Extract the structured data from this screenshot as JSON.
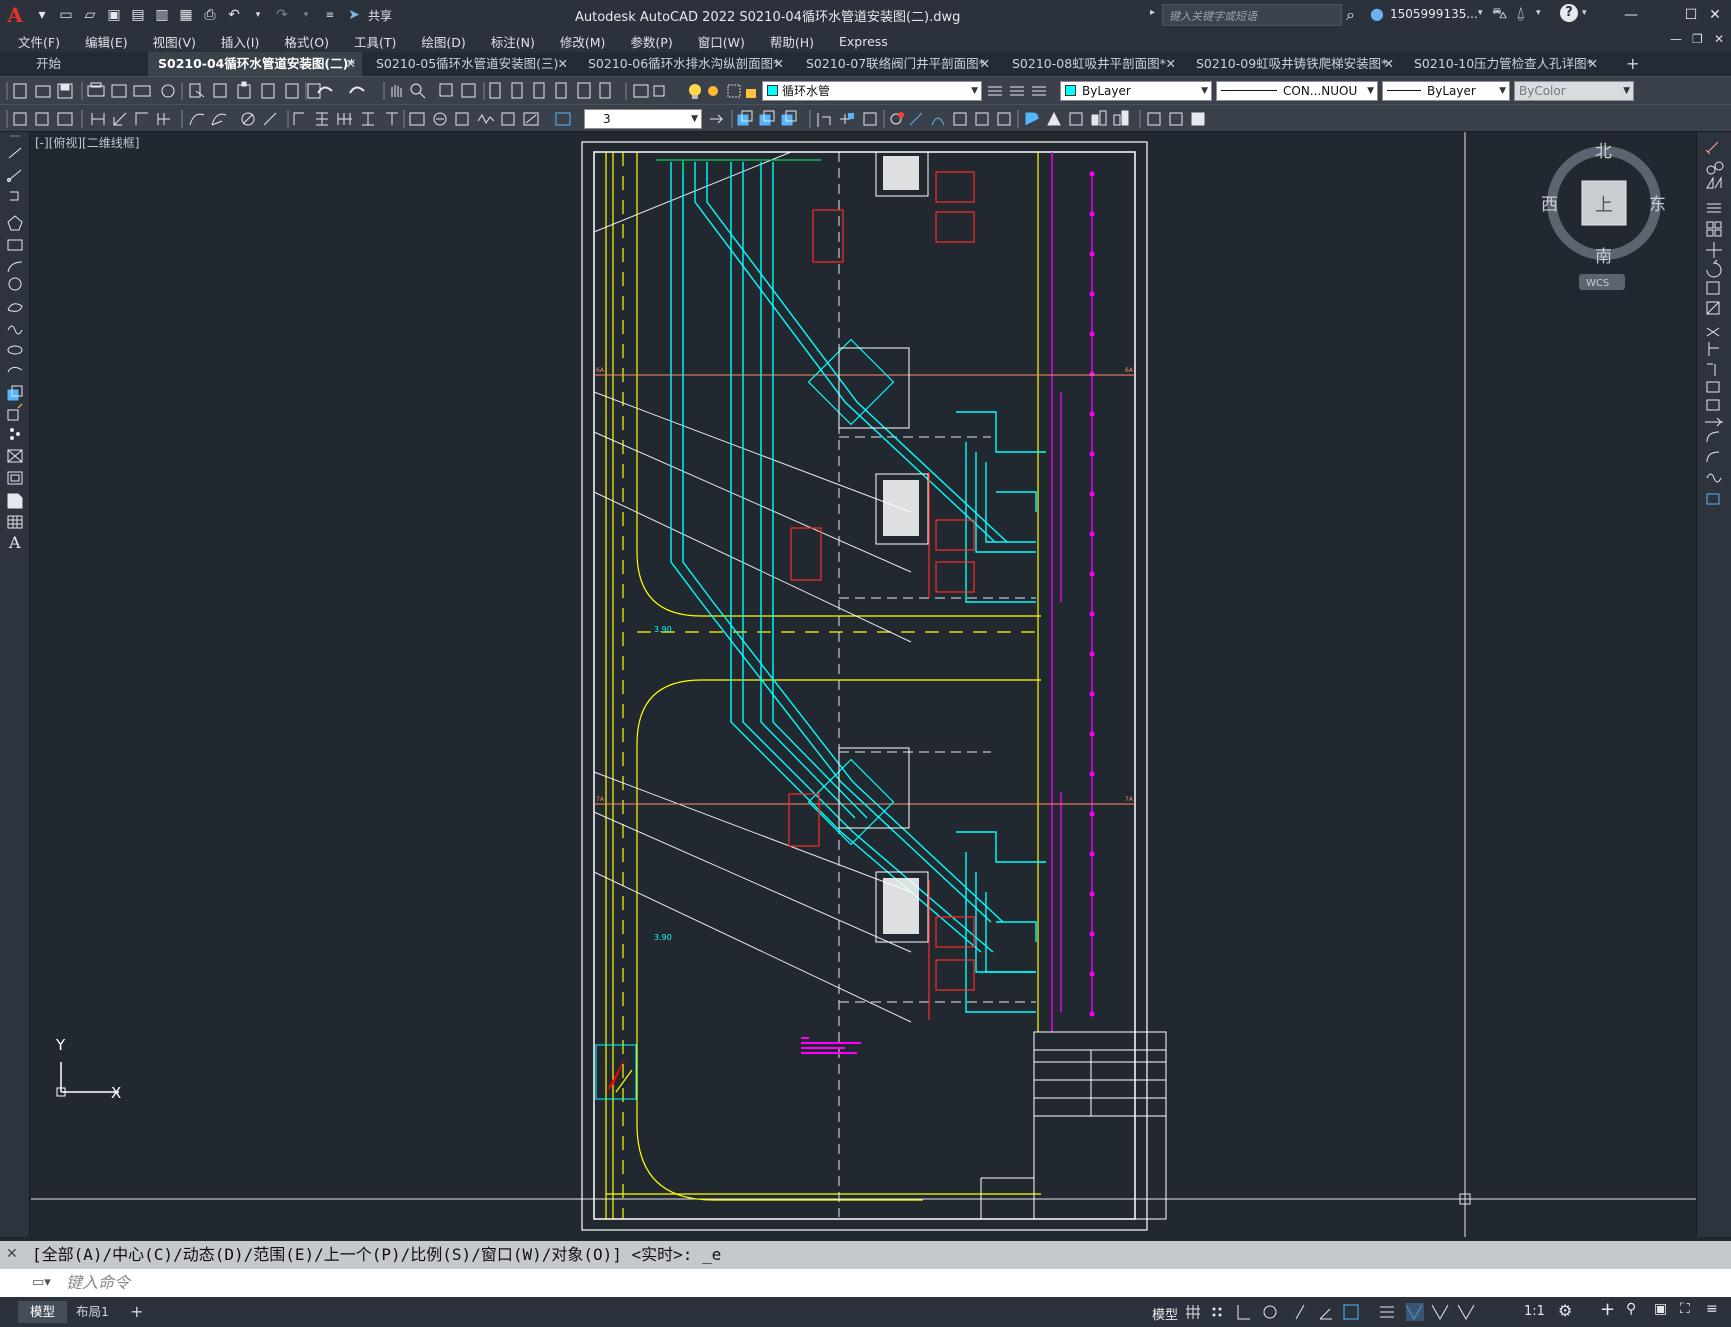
{
  "app": {
    "title": "Autodesk AutoCAD 2022    S0210-04循环水管道安装图(二).dwg",
    "search_placeholder": "键入关键字或短语",
    "user": "1505999135...",
    "share": "共享",
    "logo": "A"
  },
  "menu": [
    "文件(F)",
    "编辑(E)",
    "视图(V)",
    "插入(I)",
    "格式(O)",
    "工具(T)",
    "绘图(D)",
    "标注(N)",
    "修改(M)",
    "参数(P)",
    "窗口(W)",
    "帮助(H)",
    "Express"
  ],
  "tabs": [
    {
      "label": "开始",
      "active": false
    },
    {
      "label": "S0210-04循环水管道安装图(二)*",
      "active": true
    },
    {
      "label": "S0210-05循环水管道安装图(三)",
      "active": false
    },
    {
      "label": "S0210-06循环水排水沟纵剖面图*",
      "active": false
    },
    {
      "label": "S0210-07联络阀门井平剖面图*",
      "active": false
    },
    {
      "label": "S0210-08虹吸井平剖面图*",
      "active": false
    },
    {
      "label": "S0210-09虹吸井铸铁爬梯安装图*",
      "active": false
    },
    {
      "label": "S0210-10压力管检查人孔详图*",
      "active": false
    }
  ],
  "toolbar": {
    "layer_name": "循环水管",
    "layer_color": "#00ffff",
    "color_value": "ByLayer",
    "linetype_value": "CON...NUOU",
    "lineweight_value": "ByLayer",
    "plotstyle_value": "ByColor",
    "dim_value": "3"
  },
  "viewport": {
    "label": "[-][俯视][二维线框]",
    "cube_top": "上",
    "north": "北",
    "south": "南",
    "east": "东",
    "west": "西",
    "wcs": "WCS",
    "ucs_x": "X",
    "ucs_y": "Y"
  },
  "drawing": {
    "elevation_1": "3.90",
    "elevation_2": "3.90",
    "axis_6a": "6A",
    "axis_7a": "7A"
  },
  "command": {
    "history": "[全部(A)/中心(C)/动态(D)/范围(E)/上一个(P)/比例(S)/窗口(W)/对象(O)] <实时>: _e",
    "placeholder": "键入命令"
  },
  "status": {
    "tab_model": "模型",
    "tab_layout": "布局1",
    "model_label": "模型",
    "scale": "1:1"
  }
}
